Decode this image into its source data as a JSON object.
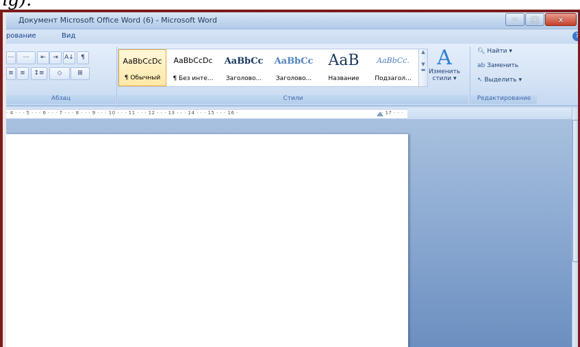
{
  "caption_fragment": "fig).",
  "window": {
    "title": "Документ Microsoft Office Word (6) - Microsoft Word",
    "minimize_glyph": "─",
    "maximize_glyph": "□",
    "close_glyph": "x"
  },
  "tabs": [
    "рование",
    "Вид"
  ],
  "help_glyph": "?",
  "paragraph_group": {
    "label": "Абзац",
    "buttons_row1": [
      "⋯",
      "⋯",
      "⇤",
      "⇥",
      "A↓",
      "¶"
    ],
    "buttons_row2": [
      "≡",
      "≡",
      "↕≡",
      "◇",
      "⊞"
    ]
  },
  "styles_group": {
    "label": "Стили",
    "items": [
      {
        "sample": "AaBbCcDc",
        "name": "¶ Обычный",
        "selected": true
      },
      {
        "sample": "AaBbCcDc",
        "name": "¶ Без инте...",
        "selected": false
      },
      {
        "sample": "AaBbCc",
        "name": "Заголово...",
        "selected": false
      },
      {
        "sample": "AaBbCc",
        "name": "Заголово...",
        "selected": false
      },
      {
        "sample": "AaB",
        "name": "Название",
        "selected": false
      },
      {
        "sample": "AaBbCc.",
        "name": "Подзагол...",
        "selected": false
      }
    ],
    "change_styles_line1": "Изменить",
    "change_styles_line2": "стили ▾"
  },
  "editing_group": {
    "label": "Редактирование",
    "find": "Найти ▾",
    "replace": "Заменить",
    "select": "Выделить ▾"
  },
  "ruler": {
    "numbers": "· 4 · · · 5 · · · 6 · · · 7 · · · 8 · · · 9 · · · 10 · · · 11 · · · 12 · · · 13 · · · 14 · · · 15 · · · 16 ·",
    "tail": "· 17 · · ·"
  },
  "colors": {
    "frame": "#7b1c1c",
    "ribbon": "#d5e3f5",
    "workspace": "#6b8fc1",
    "accent": "#15428b"
  }
}
